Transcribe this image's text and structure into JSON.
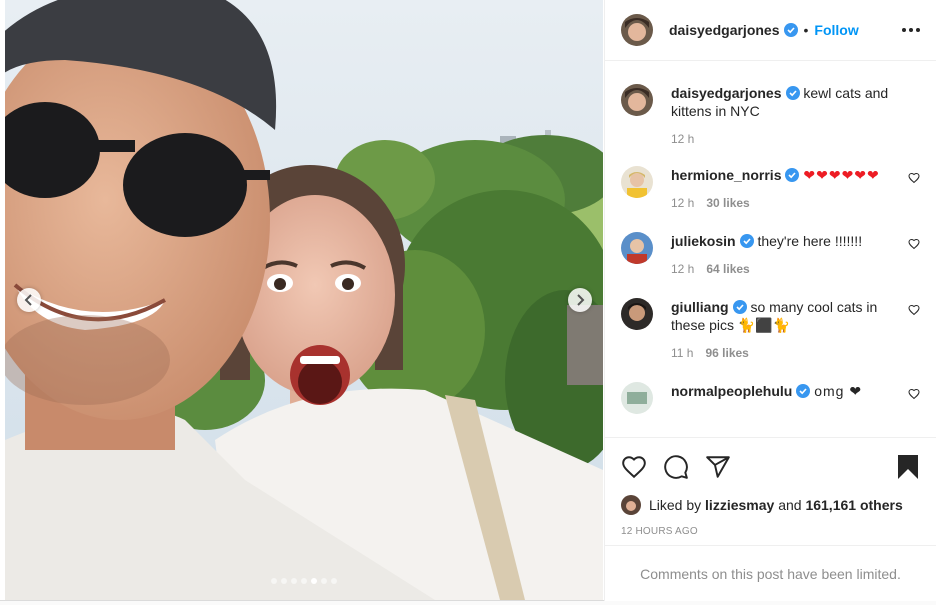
{
  "post": {
    "author": "daisyedgarjones",
    "follow_label": "Follow",
    "separator": "•",
    "caption": "kewl cats and kittens in NYC",
    "caption_time": "12 h",
    "carousel": {
      "total_slides": 7,
      "active_slide": 5
    }
  },
  "comments": [
    {
      "user": "hermione_norris",
      "text": "❤❤❤❤❤❤",
      "time": "12 h",
      "likes": "30 likes"
    },
    {
      "user": "juliekosin",
      "text": "they're here !!!!!!!",
      "time": "12 h",
      "likes": "64 likes"
    },
    {
      "user": "giulliang",
      "text": "so many cool cats in these pics 🐈⬛🐈",
      "time": "11 h",
      "likes": "96 likes"
    },
    {
      "user": "normalpeoplehulu",
      "text": "omg ❤",
      "time": "",
      "likes": ""
    }
  ],
  "likes": {
    "prefix": "Liked by",
    "user": "lizziesmay",
    "conj": "and",
    "others": "161,161 others"
  },
  "timestamp": "12 HOURS AGO",
  "comments_limited": "Comments on this post have been limited.",
  "colors": {
    "accent": "#0095f6",
    "verified": "#3897f0",
    "heart": "#ed1c24",
    "muted": "#8e8e8e"
  },
  "icons": [
    "chevron-left-icon",
    "chevron-right-icon",
    "more-icon",
    "verified-icon",
    "heart-outline-icon",
    "comment-icon",
    "share-icon",
    "bookmark-filled-icon"
  ]
}
